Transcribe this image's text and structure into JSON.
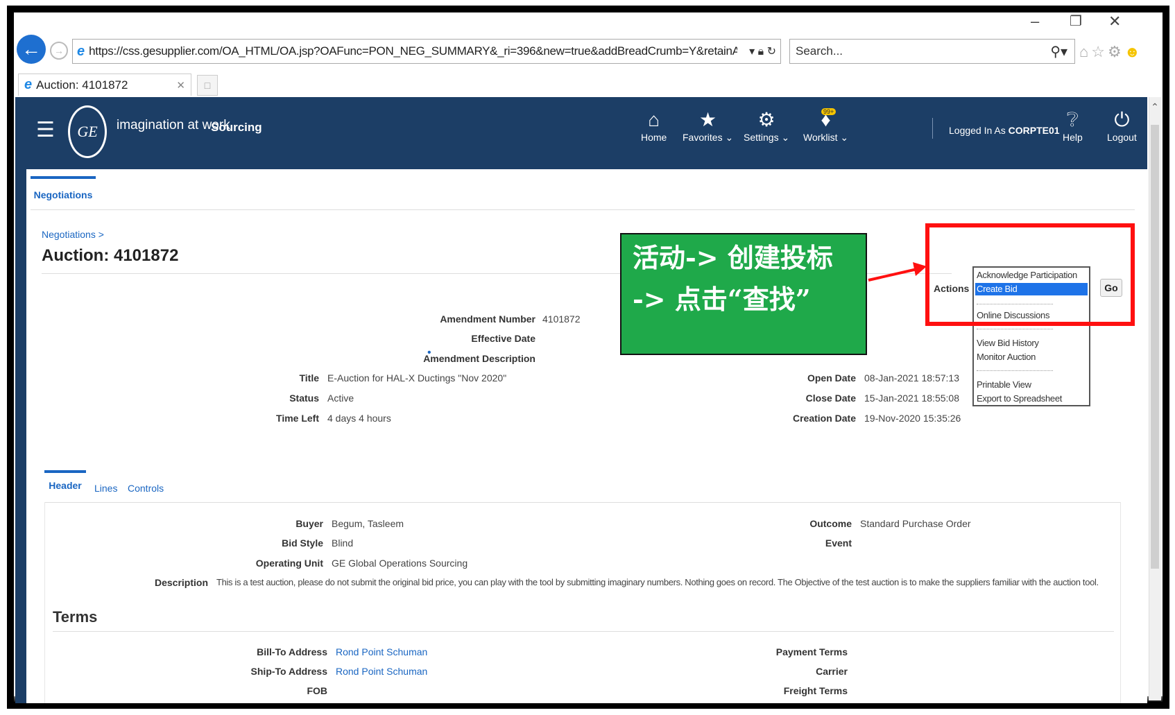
{
  "browser": {
    "url": "https://css.gesupplier.com/OA_HTML/OA.jsp?OAFunc=PON_NEG_SUMMARY&_ri=396&new=true&addBreadCrumb=Y&retainAM=N&Au",
    "search_placeholder": "Search...",
    "tab_title": "Auction: 4101872"
  },
  "app": {
    "tagline": "imagination at work",
    "name": "Sourcing",
    "nav": {
      "home": "Home",
      "favorites": "Favorites",
      "settings": "Settings",
      "worklist": "Worklist",
      "worklist_badge": "99+",
      "help": "Help",
      "logout": "Logout"
    },
    "logged_in_prefix": "Logged In As",
    "logged_in_user": "CORPTE01"
  },
  "page": {
    "main_tab": "Negotiations",
    "breadcrumb": "Negotiations >",
    "title": "Auction: 4101872",
    "fields": {
      "amendment_number_label": "Amendment Number",
      "amendment_number": "4101872",
      "effective_date_label": "Effective Date",
      "amendment_description_label": "Amendment Description",
      "title_label": "Title",
      "title": "E-Auction for HAL-X Ductings \"Nov 2020\"",
      "status_label": "Status",
      "status": "Active",
      "time_left_label": "Time Left",
      "time_left": "4 days 4 hours",
      "open_date_label": "Open Date",
      "open_date": "08-Jan-2021 18:57:13",
      "close_date_label": "Close Date",
      "close_date": "15-Jan-2021 18:55:08",
      "creation_date_label": "Creation Date",
      "creation_date": "19-Nov-2020 15:35:26"
    },
    "actions": {
      "label": "Actions",
      "options": [
        "Acknowledge Participation",
        "Create Bid",
        "Online Discussions",
        "View Bid History",
        "Monitor Auction",
        "Printable View",
        "Export to Spreadsheet"
      ],
      "selected": "Create Bid",
      "go": "Go"
    },
    "sub_tabs": [
      "Header",
      "Lines",
      "Controls"
    ],
    "header": {
      "buyer_label": "Buyer",
      "buyer": "Begum, Tasleem",
      "bid_style_label": "Bid Style",
      "bid_style": "Blind",
      "operating_unit_label": "Operating Unit",
      "operating_unit": "GE Global Operations Sourcing",
      "outcome_label": "Outcome",
      "outcome": "Standard Purchase Order",
      "event_label": "Event",
      "description_label": "Description",
      "description": "This is a test auction, please do not submit the original bid price, you can play with the tool by submitting imaginary numbers. Nothing goes on record. The Objective of the test auction is to make the suppliers familiar with the auction tool."
    },
    "terms": {
      "title": "Terms",
      "bill_to_label": "Bill-To Address",
      "bill_to": "Rond Point Schuman",
      "ship_to_label": "Ship-To Address",
      "ship_to": "Rond Point Schuman",
      "fob_label": "FOB",
      "payment_terms_label": "Payment Terms",
      "carrier_label": "Carrier",
      "freight_terms_label": "Freight Terms"
    }
  },
  "annotation": {
    "line1": "活动-> 创建投标",
    "line2": "-> 点击“查找”",
    "box_color": "#1fa94a",
    "highlight_color": "#ff1010"
  }
}
